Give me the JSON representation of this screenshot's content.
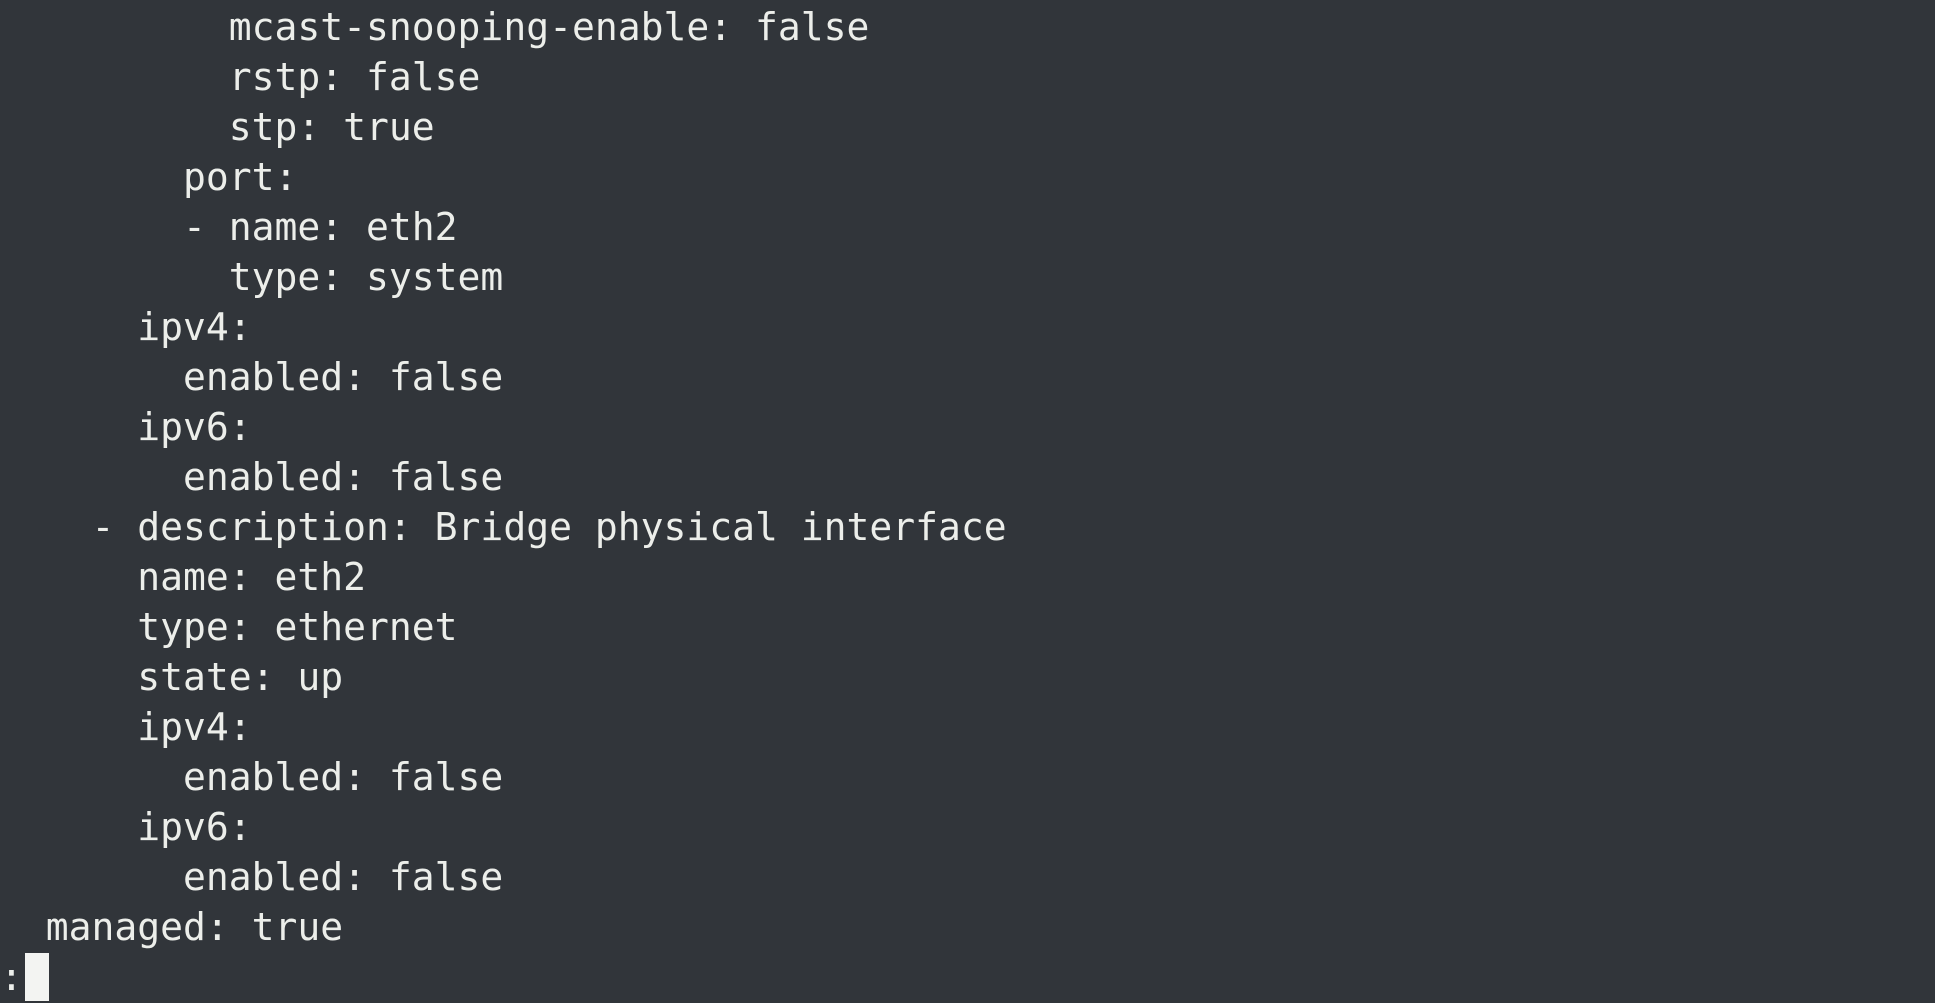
{
  "terminal": {
    "background_color": "#31353a",
    "text_color": "#eceeea",
    "lines": [
      "          mcast-snooping-enable: false",
      "          rstp: false",
      "          stp: true",
      "        port:",
      "        - name: eth2",
      "          type: system",
      "      ipv4:",
      "        enabled: false",
      "      ipv6:",
      "        enabled: false",
      "    - description: Bridge physical interface",
      "      name: eth2",
      "      type: ethernet",
      "      state: up",
      "      ipv4:",
      "        enabled: false",
      "      ipv6:",
      "        enabled: false",
      "  managed: true"
    ],
    "pager_prompt": ":"
  }
}
